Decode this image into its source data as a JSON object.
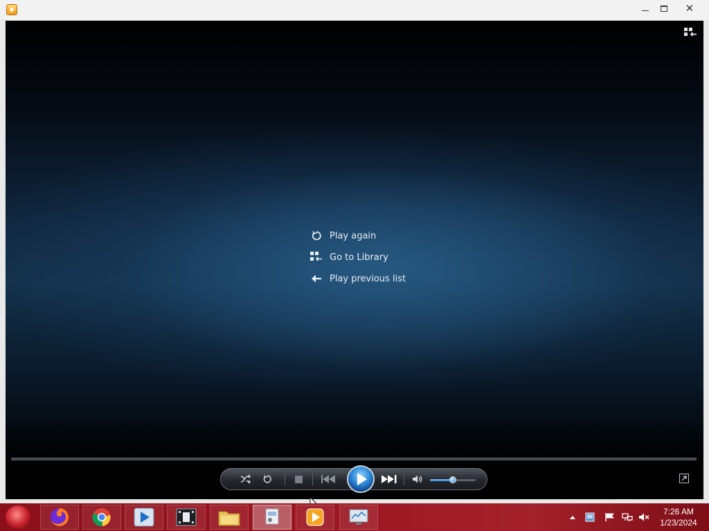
{
  "window": {
    "title": "",
    "controls": {
      "minimize": "minimize",
      "maximize": "maximize",
      "close": "✕"
    }
  },
  "player_menu": {
    "items": [
      {
        "label": "Play again",
        "icon": "replay-icon"
      },
      {
        "label": "Go to Library",
        "icon": "library-icon"
      },
      {
        "label": "Play previous list",
        "icon": "back-arrow-icon"
      }
    ]
  },
  "controls": {
    "buttons": [
      "shuffle",
      "repeat",
      "stop",
      "previous",
      "play",
      "next",
      "mute"
    ],
    "volume_level": 0.5,
    "accent_color": "#2f86d3"
  },
  "taskbar": {
    "apps": [
      "firefox",
      "chrome",
      "media-center",
      "video-editor",
      "file-explorer",
      "control-panel",
      "windows-media-player",
      "performance-monitor"
    ],
    "clock": {
      "time": "7:26 AM",
      "date": "1/23/2024"
    },
    "color": "#9b1420"
  }
}
